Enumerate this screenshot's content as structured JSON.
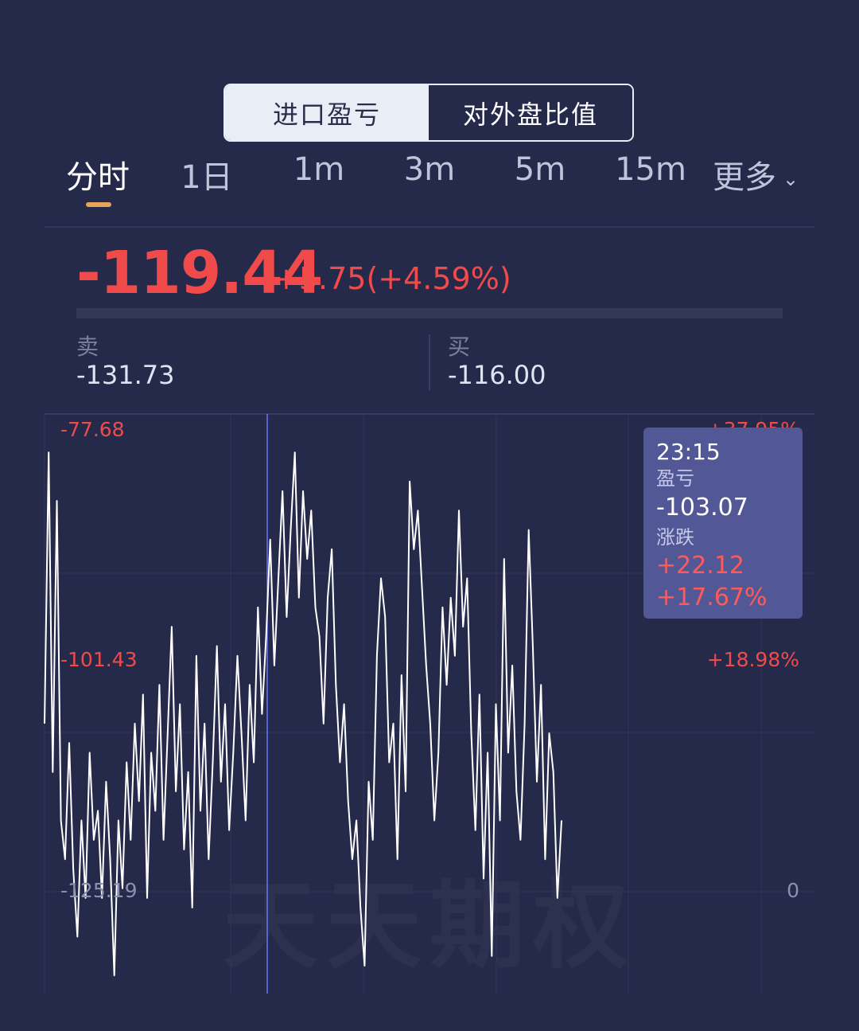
{
  "segmented": {
    "options": [
      "进口盈亏",
      "对外盘比值"
    ],
    "active_index": 0
  },
  "periods": [
    "分时",
    "1日",
    "1m",
    "3m",
    "5m",
    "15m",
    "更多"
  ],
  "active_period": "分时",
  "more_icon": "chevron-down-icon",
  "quote": {
    "price": "-119.44",
    "change": "+5.75(+4.59%)"
  },
  "sell": {
    "label": "卖",
    "value": "-131.73"
  },
  "buy": {
    "label": "买",
    "value": "-116.00"
  },
  "chart_axis": {
    "left_top": "-77.68",
    "left_mid": "-101.43",
    "left_bottom": "-125.19",
    "right_top": "+37.95%",
    "right_mid": "+18.98%",
    "right_bottom": "0"
  },
  "tooltip": {
    "time": "23:15",
    "value_label": "盈亏",
    "value": "-103.07",
    "change_label": "涨跌",
    "change": "+22.12",
    "change_pct": "+17.67%"
  },
  "watermark": "天天期权",
  "colors": {
    "background": "#262a4a",
    "up_red": "#f04a4a",
    "line": "#ffffff",
    "crosshair": "#6b74ff",
    "tooltip_bg": "#525896",
    "accent_underline": "#e9a25a"
  },
  "chart_data": {
    "type": "line",
    "title": "",
    "xlabel": "",
    "ylabel": "",
    "ylim": [
      -125.19,
      -77.68
    ],
    "right_axis": [
      "0",
      "+18.98%",
      "+37.95%"
    ],
    "series": [
      {
        "values": [
          -108,
          -80,
          -113,
          -85,
          -118,
          -122,
          -110,
          -123,
          -130,
          -118,
          -126,
          -111,
          -120,
          -117,
          -126,
          -114,
          -122,
          -134,
          -118,
          -125,
          -112,
          -120,
          -108,
          -116,
          -105,
          -126,
          -111,
          -117,
          -104,
          -120,
          -109,
          -98,
          -115,
          -106,
          -121,
          -113,
          -127,
          -101,
          -117,
          -108,
          -122,
          -112,
          -100,
          -114,
          -106,
          -119,
          -111,
          -101,
          -109,
          -118,
          -104,
          -112,
          -96,
          -107,
          -99,
          -89,
          -102,
          -93,
          -84,
          -97,
          -88,
          -80,
          -95,
          -84,
          -91,
          -86,
          -96,
          -99,
          -108,
          -95,
          -90,
          -104,
          -112,
          -106,
          -116,
          -122,
          -118,
          -127,
          -133,
          -114,
          -120,
          -101,
          -93,
          -97,
          -112,
          -108,
          -122,
          -103,
          -115,
          -83,
          -90,
          -86,
          -94,
          -102,
          -108,
          -118,
          -111,
          -96,
          -104,
          -95,
          -101,
          -86,
          -98,
          -93,
          -109,
          -119,
          -105,
          -124,
          -111,
          -132,
          -106,
          -118,
          -91,
          -111,
          -102,
          -115,
          -120,
          -108,
          -88,
          -100,
          -114,
          -104,
          -122,
          -109,
          -113,
          -126,
          -118
        ],
        "x_range": [
          "",
          ""
        ]
      }
    ],
    "crosshair_time": "23:15"
  }
}
